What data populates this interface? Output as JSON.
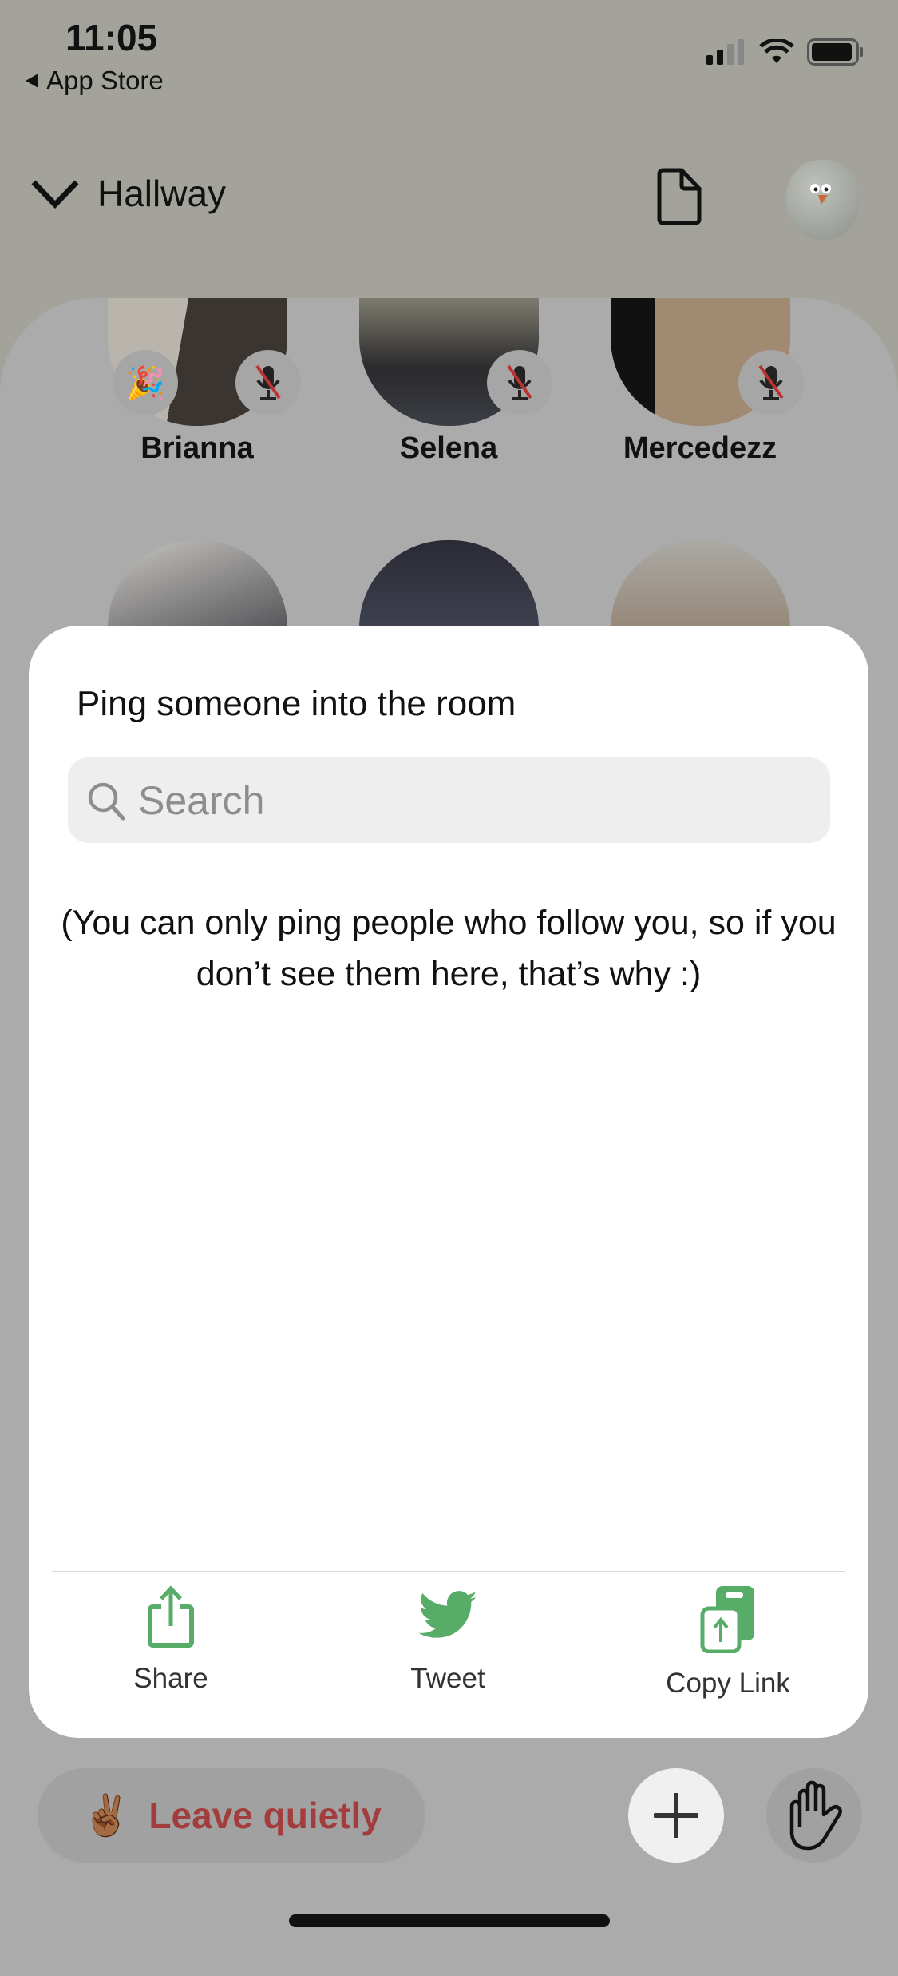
{
  "status_bar": {
    "time": "11:05",
    "back_label": "App Store"
  },
  "header": {
    "title": "Hallway",
    "icons": [
      "chevron-down-icon",
      "document-icon",
      "avatar"
    ]
  },
  "room": {
    "speakers": [
      {
        "name": "Brianna",
        "badge": "🎉",
        "muted": true
      },
      {
        "name": "Selena",
        "muted": true
      },
      {
        "name": "Mercedezz",
        "muted": true
      }
    ]
  },
  "sheet": {
    "title": "Ping someone into the room",
    "search_placeholder": "Search",
    "search_value": "",
    "note": "(You can only ping people who follow you, so if you don’t see them here, that’s why :)",
    "actions": [
      {
        "label": "Share",
        "icon": "share-icon"
      },
      {
        "label": "Tweet",
        "icon": "twitter-icon"
      },
      {
        "label": "Copy Link",
        "icon": "copy-link-icon"
      }
    ],
    "accent_color": "#57ad67"
  },
  "bottom_bar": {
    "leave_emoji": "✌🏾",
    "leave_label": "Leave quietly",
    "leave_color": "#a33d3d"
  }
}
